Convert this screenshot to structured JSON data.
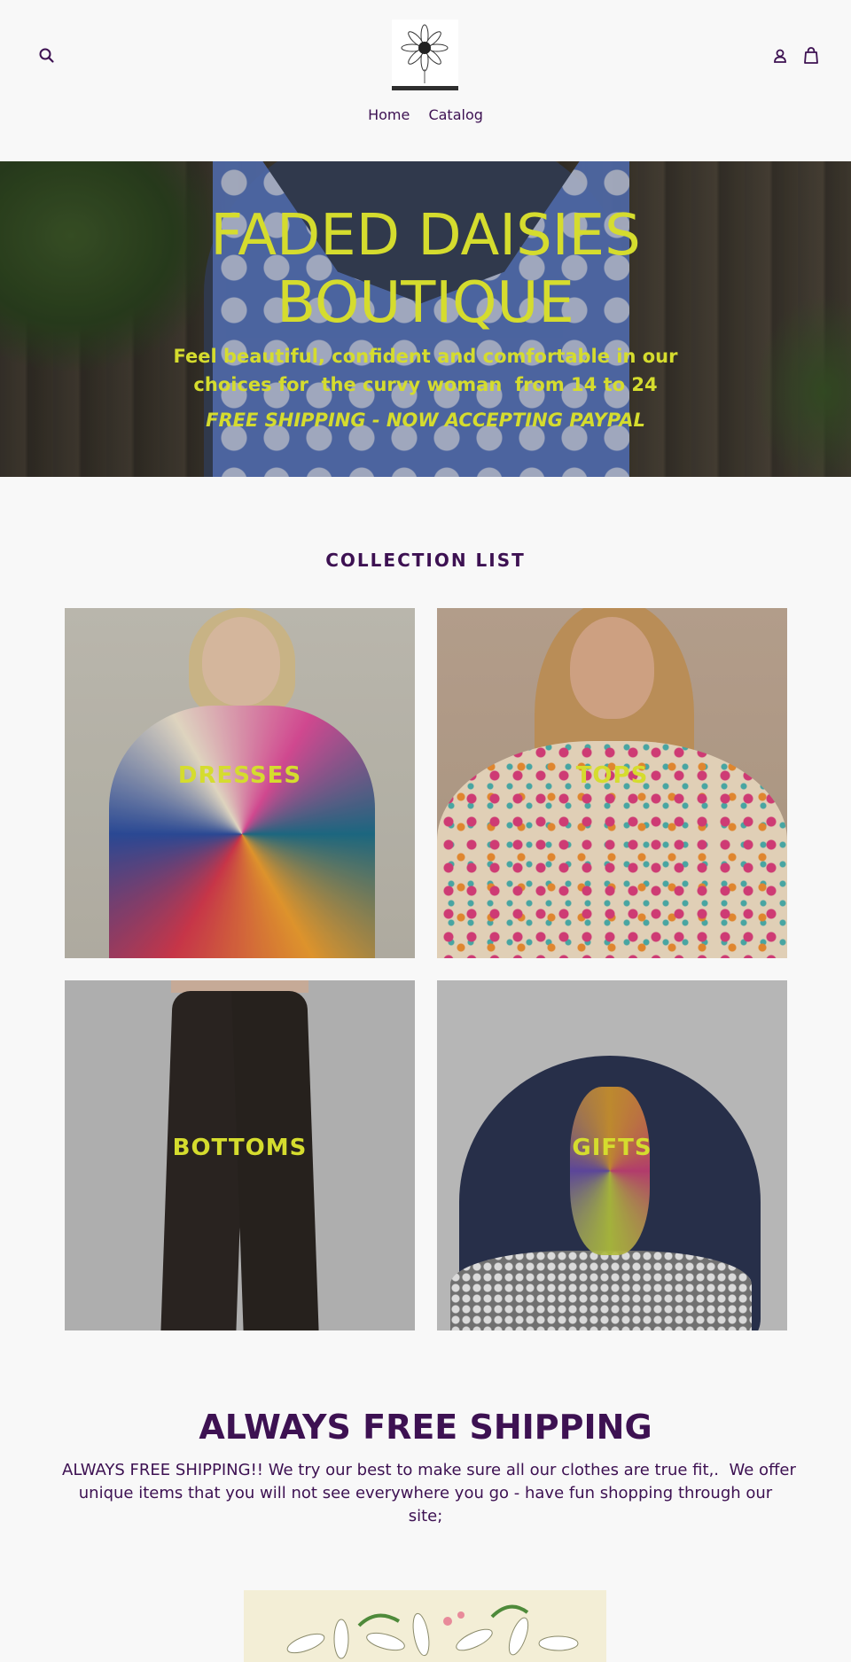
{
  "header": {
    "nav": [
      {
        "label": "Home"
      },
      {
        "label": "Catalog"
      }
    ]
  },
  "hero": {
    "title_line1": "FADED DAISIES",
    "title_line2": "BOUTIQUE",
    "subtitle_line1": "Feel beautiful, confident and comfortable in our",
    "subtitle_line2": "choices for  the curvy woman  from 14 to 24",
    "shipping": "FREE SHIPPING - NOW ACCEPTING PAYPAL"
  },
  "collections": {
    "title": "COLLECTION LIST",
    "items": [
      {
        "label": "DRESSES"
      },
      {
        "label": "TOPS"
      },
      {
        "label": "BOTTOMS"
      },
      {
        "label": "GIFTS"
      }
    ]
  },
  "shipping_section": {
    "title": "ALWAYS FREE SHIPPING",
    "text_line1": "ALWAYS FREE SHIPPING!! We try our best to make sure all our clothes are true fit,.  We offer",
    "text_line2": "unique items that you will not see everywhere you go - have fun shopping through our site;"
  },
  "colors": {
    "accent": "#3d1152",
    "hero_text": "#d5dc2e",
    "background": "#f8f8f8"
  },
  "icons": [
    "search-icon",
    "account-icon",
    "cart-icon",
    "daisy-logo"
  ]
}
